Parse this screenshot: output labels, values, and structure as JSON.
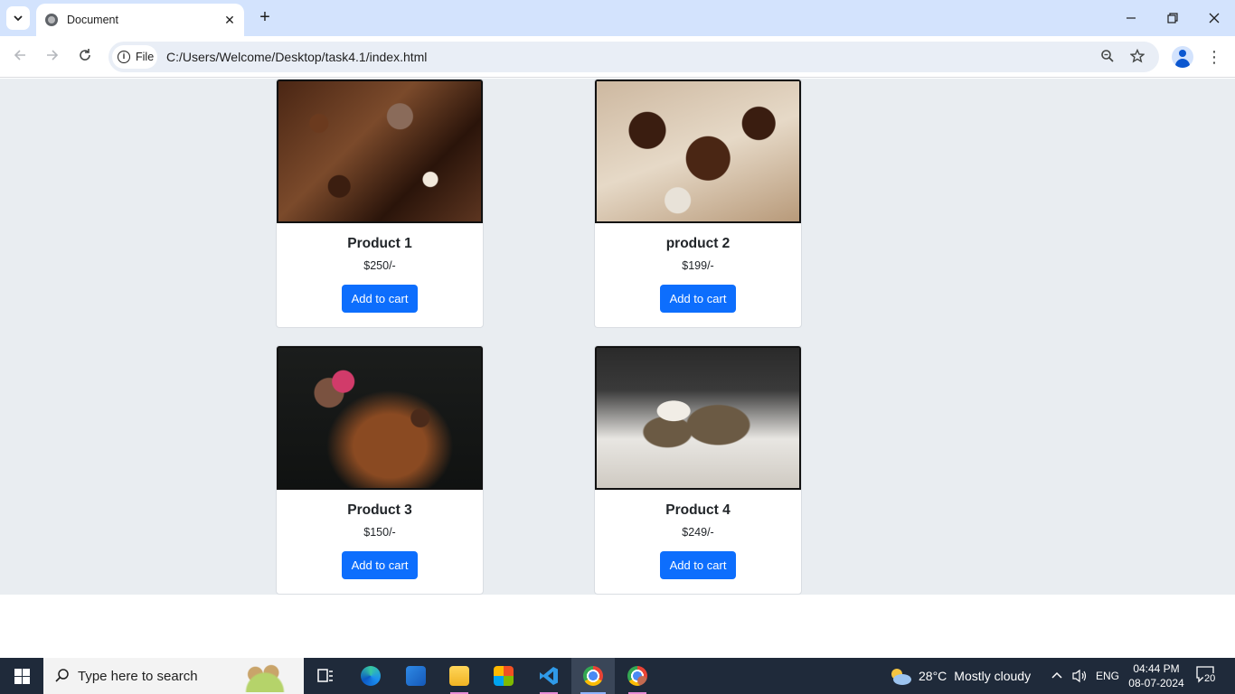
{
  "browser": {
    "tab_title": "Document",
    "chip_label": "File",
    "url": "C:/Users/Welcome/Desktop/task4.1/index.html"
  },
  "products": [
    {
      "name": "Product 1",
      "price": "$250/-",
      "button": "Add to cart"
    },
    {
      "name": "product 2",
      "price": "$199/-",
      "button": "Add to cart"
    },
    {
      "name": "Product 3",
      "price": "$150/-",
      "button": "Add to cart"
    },
    {
      "name": "Product 4",
      "price": "$249/-",
      "button": "Add to cart"
    }
  ],
  "taskbar": {
    "search_placeholder": "Type here to search",
    "weather_temp": "28°C",
    "weather_desc": "Mostly cloudy",
    "language": "ENG",
    "time": "04:44 PM",
    "date": "08-07-2024",
    "notification_count": "20"
  },
  "colors": {
    "accent_button": "#0d6efd",
    "page_background": "#e9edf1",
    "tabstrip": "#d3e3fd"
  }
}
